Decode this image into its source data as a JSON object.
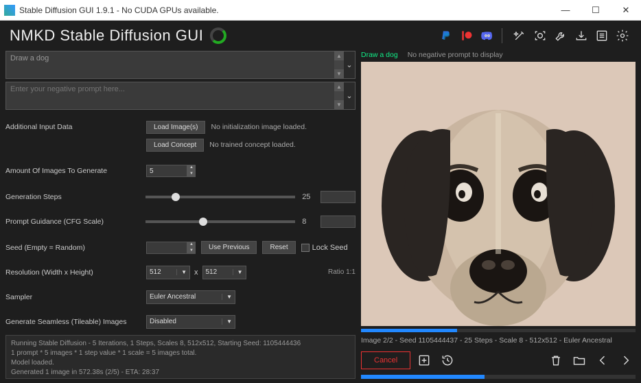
{
  "window": {
    "title": "Stable Diffusion GUI 1.9.1 - No CUDA GPUs available."
  },
  "brand": "NMKD Stable Diffusion GUI",
  "prompt": {
    "value": "Draw a dog",
    "negative_placeholder": "Enter your negative prompt here..."
  },
  "labels": {
    "additional": "Additional Input Data",
    "amount": "Amount Of Images To Generate",
    "steps": "Generation Steps",
    "cfg": "Prompt Guidance (CFG Scale)",
    "seed": "Seed (Empty = Random)",
    "res": "Resolution (Width x Height)",
    "sampler": "Sampler",
    "seamless": "Generate Seamless (Tileable) Images"
  },
  "buttons": {
    "load_images": "Load Image(s)",
    "load_concept": "Load Concept",
    "use_prev": "Use Previous",
    "reset": "Reset",
    "lock_seed": "Lock Seed",
    "cancel": "Cancel"
  },
  "hints": {
    "no_init": "No initialization image loaded.",
    "no_concept": "No trained concept loaded."
  },
  "values": {
    "amount": "5",
    "steps": "25",
    "cfg": "8",
    "seed": "",
    "width": "512",
    "height": "512",
    "ratio": "Ratio 1:1",
    "sampler": "Euler Ancestral",
    "seamless": "Disabled",
    "x": "x"
  },
  "log": {
    "l1": "Running Stable Diffusion - 5 Iterations, 1 Steps, Scales 8, 512x512, Starting Seed: 1105444436",
    "l2": "1 prompt * 5 images * 1 step value * 1 scale = 5 images total.",
    "l3": "Model loaded.",
    "l4": "Generated 1 image in 572.38s (2/5) - ETA: 28:37"
  },
  "preview": {
    "prompt": "Draw a dog",
    "neg": "No negative prompt to display",
    "meta": "Image 2/2 - Seed 1105444437 - 25 Steps - Scale 8 - 512x512 - Euler Ancestral"
  }
}
